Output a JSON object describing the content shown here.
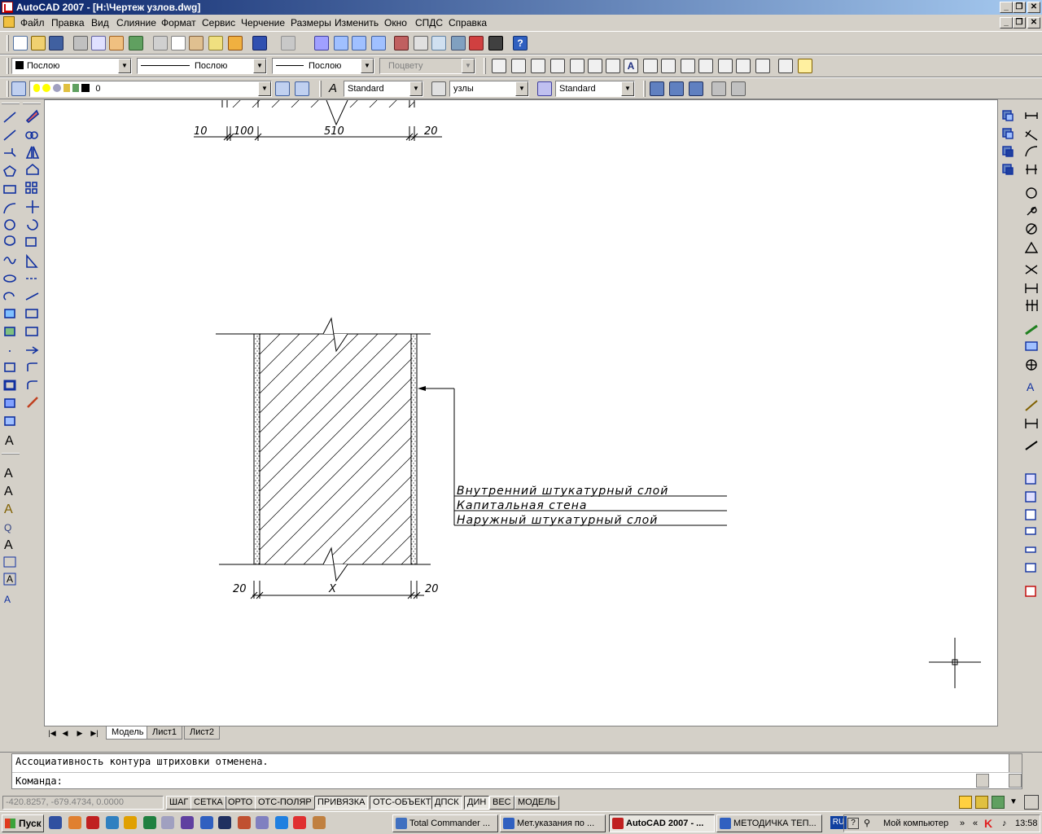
{
  "window": {
    "title": "AutoCAD 2007 - [H:\\Чертеж узлов.dwg]",
    "min_label": "_",
    "restore_label": "❐",
    "close_label": "✕"
  },
  "menu": {
    "items": [
      "Файл",
      "Правка",
      "Вид",
      "Слияние",
      "Формат",
      "Сервис",
      "Черчение",
      "Размеры",
      "Изменить",
      "Окно",
      "СПДС",
      "Справка"
    ]
  },
  "properties": {
    "color": "Послою",
    "linetype": "Послою",
    "lineweight": "Послою",
    "plotstyle": "Поцвету"
  },
  "layers": {
    "current": "0"
  },
  "styles": {
    "text_style": "Standard",
    "dim_style": "узлы",
    "table_style": "Standard"
  },
  "drawing": {
    "top_dims": [
      "10",
      "100",
      "510",
      "20"
    ],
    "bottom_dims": [
      "20",
      "X",
      "20"
    ],
    "leader_labels": [
      "Внутренний  штукатурный  слой",
      "Капитальная  стена",
      "Наружный  штукатурный  слой"
    ]
  },
  "layout_tabs": [
    "Модель",
    "Лист1",
    "Лист2"
  ],
  "layout_nav": [
    "|◀",
    "◀",
    "▶",
    "▶|"
  ],
  "command": {
    "history": "Ассоциативность контура штриховки отменена.",
    "prompt": "Команда:"
  },
  "status": {
    "coords": "-420.8257, -679.4734, 0.0000",
    "toggles": [
      "ШАГ",
      "СЕТКА",
      "ОРТО",
      "ОТС-ПОЛЯР",
      "ПРИВЯЗКА",
      "ОТС-ОБЪЕКТ",
      "ДПСК",
      "ДИН",
      "ВЕС",
      "МОДЕЛЬ"
    ]
  },
  "taskbar": {
    "start": "Пуск",
    "tasks": [
      "Total Commander ...",
      "Мет.указания по ...",
      "AutoCAD 2007 - ...",
      "МЕТОДИЧКА ТЕП..."
    ],
    "lang": "RU",
    "tray_label": "Мой компьютер",
    "clock": "13:58"
  }
}
